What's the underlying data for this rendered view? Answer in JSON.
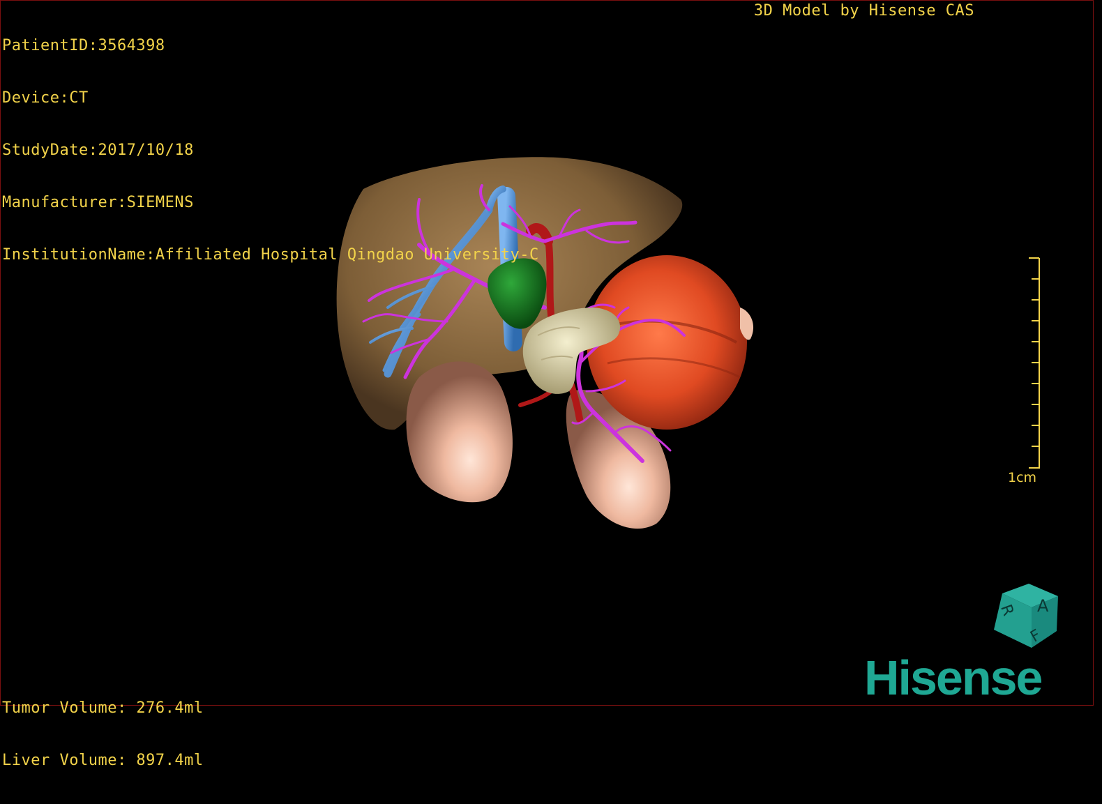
{
  "info": {
    "patient_id": "PatientID:3564398",
    "device": "Device:CT",
    "study_date": "StudyDate:2017/10/18",
    "manufacturer": "Manufacturer:SIEMENS",
    "institution": "InstitutionName:Affiliated Hospital Qingdao University-C"
  },
  "brand_label": "3D Model by Hisense CAS",
  "volumes": {
    "tumor": "Tumor Volume: 276.4ml",
    "liver": "Liver Volume: 897.4ml"
  },
  "scale_bar": {
    "label": "1cm"
  },
  "orientation_cube": {
    "labels": [
      "A",
      "R",
      "F"
    ]
  },
  "logo": "Hisense",
  "colors": {
    "overlay_text": "#f2d34a",
    "liver": "#8a6a40",
    "tumor": "#e0502a",
    "portal_vein": "#5a9be0",
    "hepatic_vessels": "#cc33dd",
    "gallbladder": "#1a7a22",
    "artery": "#b01818",
    "pancreas": "#ddd6b0",
    "kidneys": "#f0c0a8",
    "logo": "#1fa894"
  }
}
